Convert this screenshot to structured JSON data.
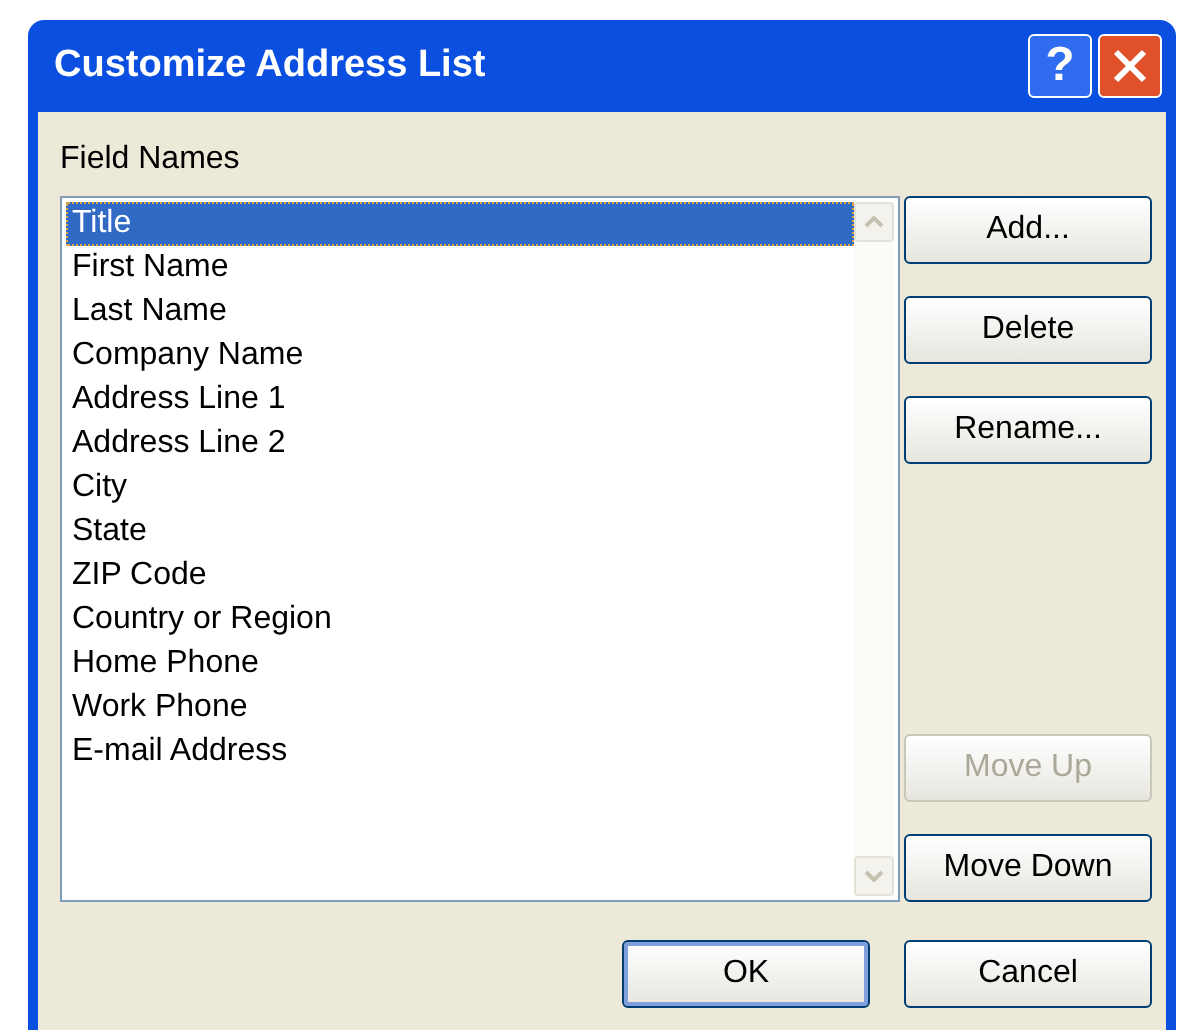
{
  "window": {
    "title": "Customize Address List"
  },
  "title_buttons": [
    {
      "kind": "help",
      "label": "?"
    },
    {
      "kind": "close"
    }
  ],
  "field_names": {
    "label": "Field Names",
    "items": [
      {
        "text": "Title",
        "selected": true
      },
      {
        "text": "First Name",
        "selected": false
      },
      {
        "text": "Last Name",
        "selected": false
      },
      {
        "text": "Company Name",
        "selected": false
      },
      {
        "text": "Address Line 1",
        "selected": false
      },
      {
        "text": "Address Line 2",
        "selected": false
      },
      {
        "text": "City",
        "selected": false
      },
      {
        "text": "State",
        "selected": false
      },
      {
        "text": "ZIP Code",
        "selected": false
      },
      {
        "text": "Country or Region",
        "selected": false
      },
      {
        "text": "Home Phone",
        "selected": false
      },
      {
        "text": "Work Phone",
        "selected": false
      },
      {
        "text": "E-mail Address",
        "selected": false
      }
    ]
  },
  "side_buttons": {
    "top": [
      {
        "label": "Add...",
        "disabled": false
      },
      {
        "label": "Delete",
        "disabled": false
      },
      {
        "label": "Rename...",
        "disabled": false
      }
    ],
    "bottom": [
      {
        "label": "Move Up",
        "disabled": true
      },
      {
        "label": "Move Down",
        "disabled": false
      }
    ]
  },
  "footer_buttons": [
    {
      "label": "OK",
      "default": true
    },
    {
      "label": "Cancel",
      "default": false
    }
  ]
}
